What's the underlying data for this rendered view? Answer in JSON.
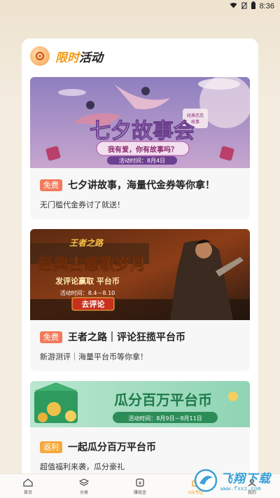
{
  "status_bar": {
    "time": "8:36",
    "icons": [
      "wifi-icon",
      "no-sim-icon",
      "battery-icon"
    ]
  },
  "section": {
    "title_highlight": "限时",
    "title_rest": "活动",
    "icon": "activity-badge-icon"
  },
  "activities": [
    {
      "banner_title": "七夕故事会",
      "banner_subtitle": "我有爱，你有故事吗？",
      "banner_date": "活动时间：8月4日",
      "banner_note_1": "经典恋恋",
      "banner_note_2": "故事",
      "tag": "免费",
      "title": "七夕讲故事，海量代金券等你拿！",
      "desc": "无门槛代金券讨了就送！"
    },
    {
      "banner_logo": "王者之路",
      "banner_title": "经典古惑敬岁月",
      "banner_subtitle": "发评论赢取 平台币",
      "banner_date": "活动时间：8.4－8.10",
      "banner_button": "去评论",
      "tag": "免费",
      "title": "王者之路｜评论狂揽平台币",
      "desc": "新游测评｜海量平台币等你拿！"
    },
    {
      "banner_title": "瓜分百万平台币",
      "banner_date": "活动时间：8月9日－8月11日",
      "tag": "返利",
      "title": "一起瓜分百万平台币",
      "desc": "超值福利来袭，瓜分豪礼"
    }
  ],
  "tabbar": [
    {
      "label": "首页",
      "icon": "home-icon"
    },
    {
      "label": "分类",
      "icon": "layers-icon"
    },
    {
      "label": "赚现金",
      "icon": "cash-icon"
    },
    {
      "label": "0元专区",
      "icon": "gift-icon"
    },
    {
      "label": "我的",
      "icon": "user-icon"
    }
  ],
  "watermark": {
    "text": "飞翔下载",
    "url": "www.fxxz.com"
  },
  "colors": {
    "accent": "#f29a16",
    "tag_free": "#f07b5a",
    "tag_rebate": "#f5a93d",
    "page_bg": "#f3ecdf"
  }
}
